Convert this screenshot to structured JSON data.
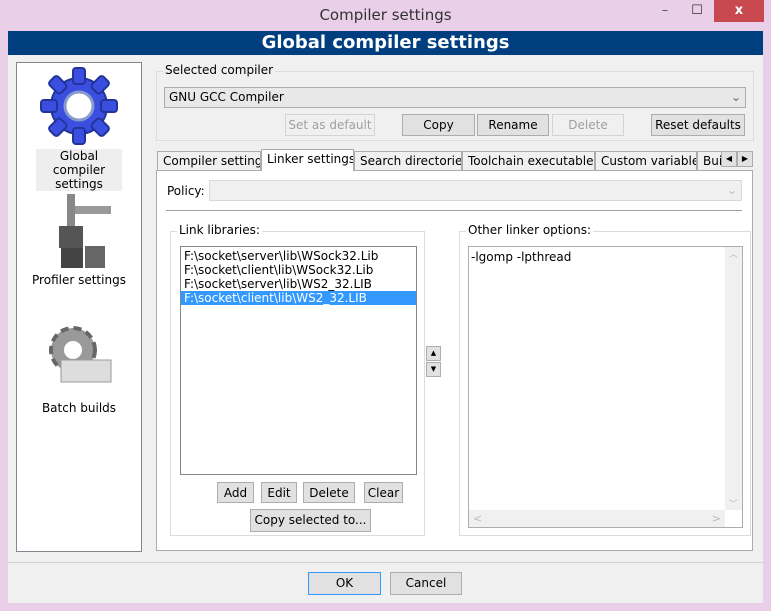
{
  "window": {
    "title": "Compiler settings",
    "minimize": "–",
    "maximize": "☐",
    "close": "x"
  },
  "header": {
    "title": "Global compiler settings"
  },
  "sidebar": {
    "items": [
      {
        "label": "Global compiler settings",
        "icon": "gear-icon"
      },
      {
        "label": "Profiler settings",
        "icon": "caliper-icon"
      },
      {
        "label": "Batch builds",
        "icon": "batch-gear-icon"
      }
    ]
  },
  "compiler": {
    "group_label": "Selected compiler",
    "value": "GNU GCC Compiler",
    "buttons": {
      "set_default": "Set as default",
      "copy": "Copy",
      "rename": "Rename",
      "delete": "Delete",
      "reset": "Reset defaults"
    }
  },
  "tabs": [
    {
      "label": "Compiler settings"
    },
    {
      "label": "Linker settings"
    },
    {
      "label": "Search directories"
    },
    {
      "label": "Toolchain executables"
    },
    {
      "label": "Custom variables"
    },
    {
      "label": "Build options"
    }
  ],
  "linker": {
    "policy_label": "Policy:",
    "policy_value": "",
    "link_libraries_label": "Link libraries:",
    "libraries": [
      "F:\\socket\\server\\lib\\WSock32.Lib",
      "F:\\socket\\client\\lib\\WSock32.Lib",
      "F:\\socket\\server\\lib\\WS2_32.LIB",
      "F:\\socket\\client\\lib\\WS2_32.LIB"
    ],
    "selected_index": 3,
    "buttons": {
      "add": "Add",
      "edit": "Edit",
      "delete": "Delete",
      "clear": "Clear",
      "copy_to": "Copy selected to..."
    },
    "other_label": "Other linker options:",
    "other_value": "-lgomp -lpthread"
  },
  "footer": {
    "ok": "OK",
    "cancel": "Cancel"
  }
}
